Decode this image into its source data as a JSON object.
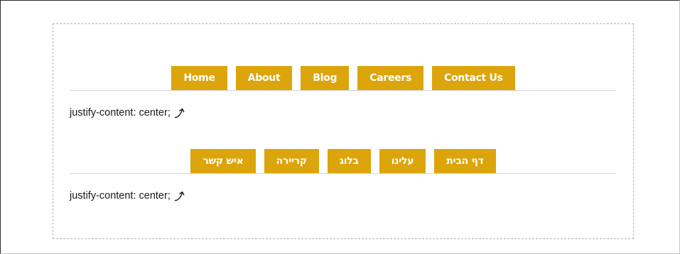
{
  "ltr_nav": {
    "items": [
      "Home",
      "About",
      "Blog",
      "Careers",
      "Contact Us"
    ]
  },
  "ltr_caption": "justify-content: center;",
  "rtl_nav": {
    "items": [
      "דף הבית",
      "עלינו",
      "בלוג",
      "קריירה",
      "איש קשר"
    ]
  },
  "rtl_caption": "justify-content: center;",
  "colors": {
    "tab_background": "#dba50b",
    "tab_text": "#ffffff",
    "divider": "#d3d3d3",
    "dashed_border": "#b3b3b3"
  },
  "icons": [
    "curved-arrow-icon"
  ]
}
